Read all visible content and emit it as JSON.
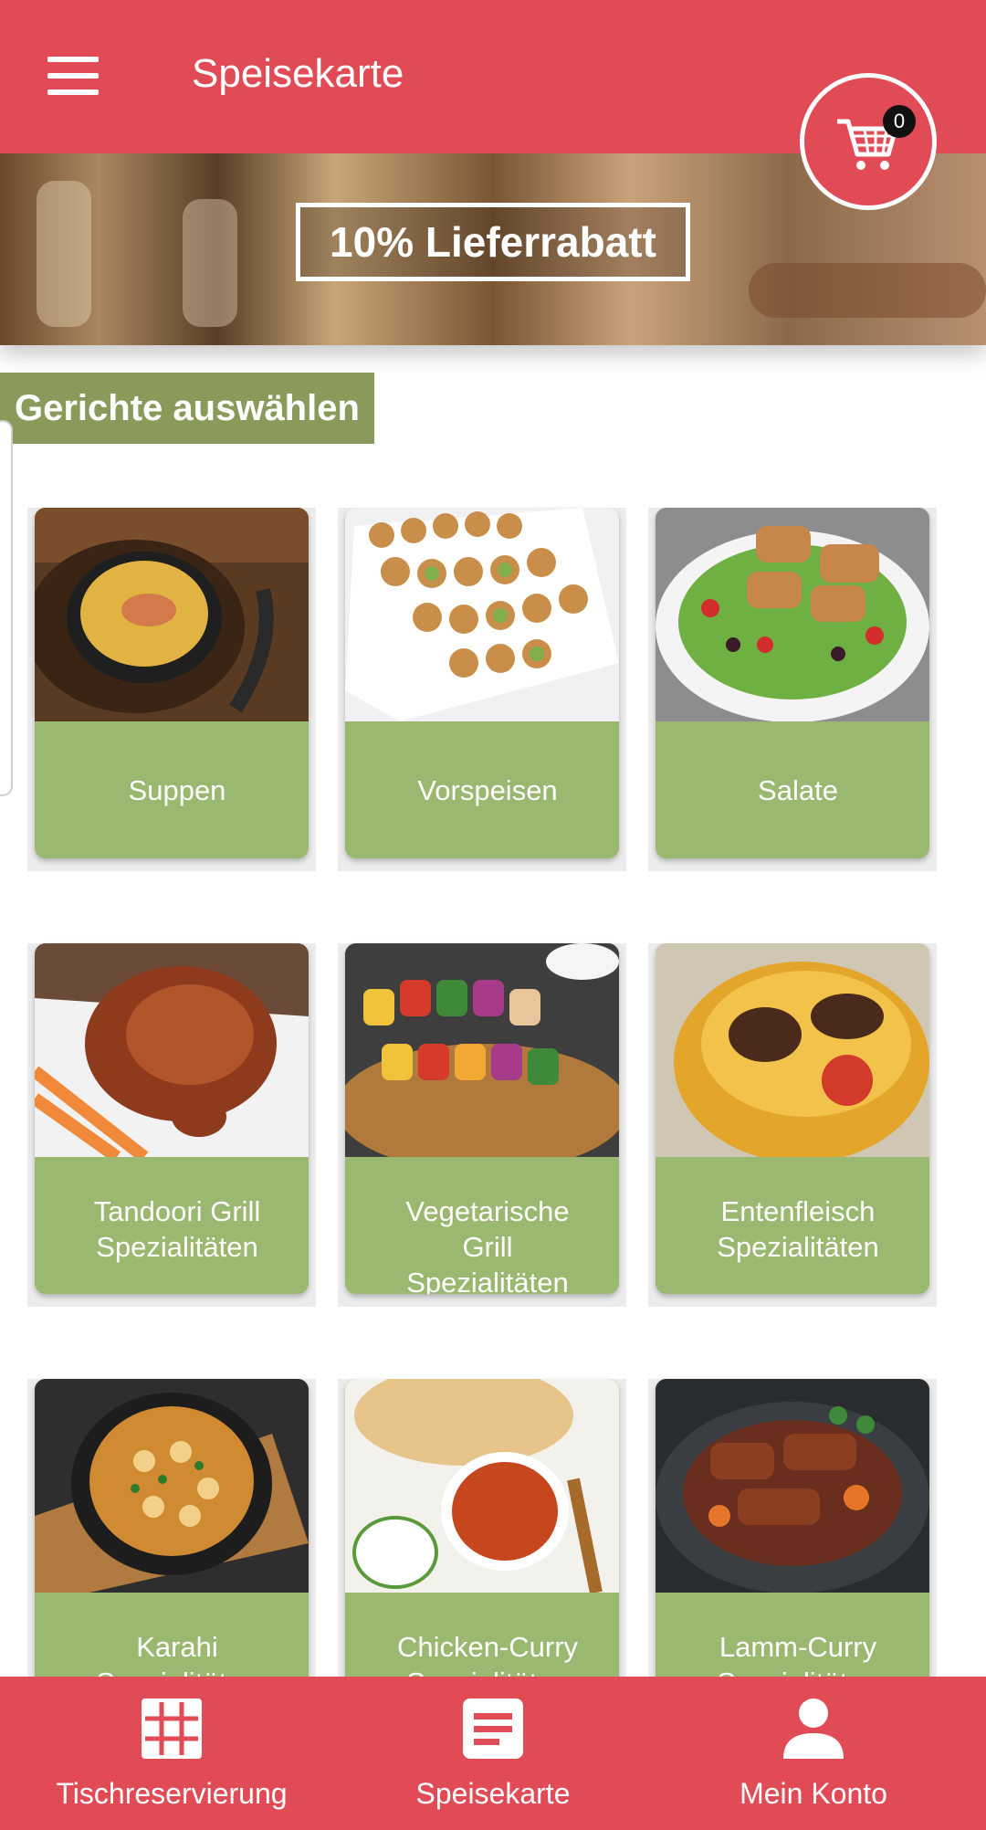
{
  "appbar": {
    "title": "Speisekarte",
    "menu_icon": "menu-icon",
    "cart_icon": "cart-icon",
    "cart_count": "0"
  },
  "banner": {
    "promo": "10% Lieferrabatt"
  },
  "section": {
    "title": "Gerichte auswählen"
  },
  "categories": [
    {
      "label": "Suppen",
      "photo": "soup-photo"
    },
    {
      "label": "Vorspeisen",
      "photo": "appetizer-platter-photo"
    },
    {
      "label": "Salate",
      "photo": "salad-photo"
    },
    {
      "label": "Tandoori Grill Spezialitäten",
      "photo": "tandoori-chicken-photo"
    },
    {
      "label": "Vegetarische Grill Spezialitäten",
      "photo": "veg-skewers-photo"
    },
    {
      "label": "Entenfleisch Spezialitäten",
      "photo": "duck-dish-photo"
    },
    {
      "label": "Karahi Spezialitäten",
      "photo": "karahi-pot-photo"
    },
    {
      "label": "Chicken-Curry Spezialitäten",
      "photo": "chicken-curry-photo"
    },
    {
      "label": "Lamm-Curry Spezialitäten",
      "photo": "lamb-curry-photo"
    }
  ],
  "bottom_nav": [
    {
      "label": "Tischreservierung",
      "icon": "grid-icon"
    },
    {
      "label": "Speisekarte",
      "icon": "menu-document-icon"
    },
    {
      "label": "Mein Konto",
      "icon": "person-icon"
    }
  ],
  "colors": {
    "primary": "#e14b55",
    "section_label": "#8a9a5b",
    "card_label": "#9bb870"
  }
}
